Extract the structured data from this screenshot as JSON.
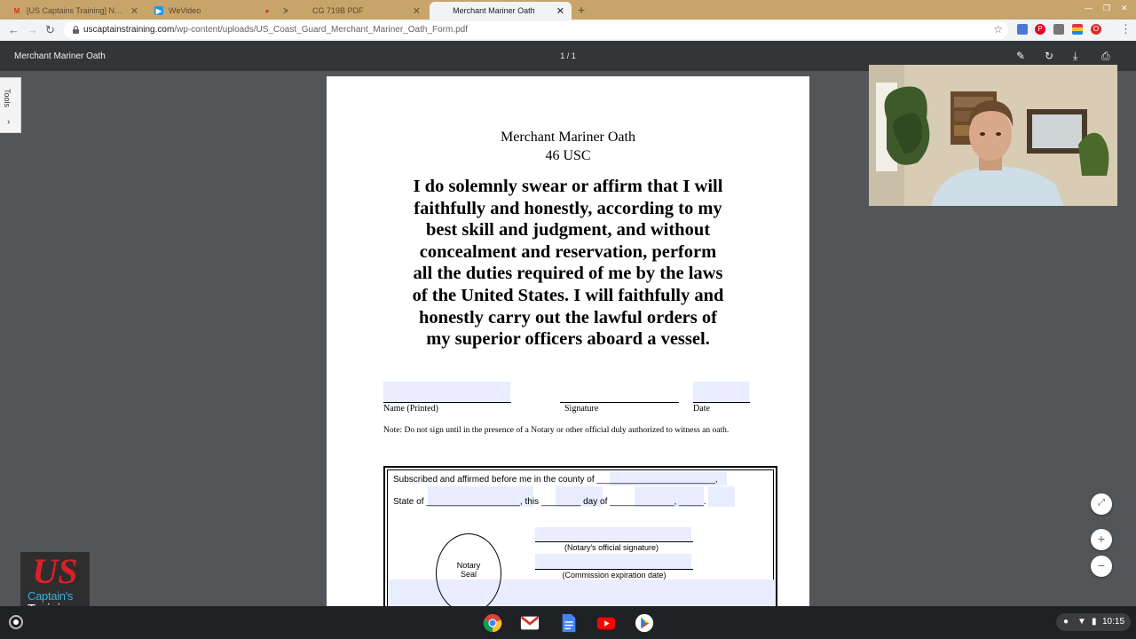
{
  "browser": {
    "tabs": [
      {
        "title": "[US Captains Training] New own...",
        "active": false
      },
      {
        "title": "WeVideo",
        "active": false
      },
      {
        "title": "",
        "active": false
      },
      {
        "title": "CG 719B PDF",
        "active": false
      },
      {
        "title": "Merchant Mariner Oath",
        "active": true
      }
    ],
    "new_tab_symbol": "+",
    "url_host": "uscaptainstraining.com",
    "url_path": "/wp-content/uploads/US_Coast_Guard_Merchant_Mariner_Oath_Form.pdf"
  },
  "pdf_viewer": {
    "title": "Merchant Mariner Oath",
    "page_indicator": "1 / 1",
    "tools_label": "Tools"
  },
  "document": {
    "title": "Merchant Mariner Oath",
    "subtitle": "46 USC",
    "oath_lines": [
      "I do solemnly swear or affirm that I will",
      "faithfully and honestly, according to my",
      "best skill and judgment, and without",
      "concealment and reservation, perform",
      "all the duties required of me by the laws",
      "of the United States. I will faithfully and",
      "honestly carry out the lawful orders of",
      "my superior officers aboard a vessel."
    ],
    "field_name_label": "Name (Printed)",
    "field_signature_label": "Signature",
    "field_date_label": "Date",
    "note": "Note: Do not sign until in the presence of a Notary or other official duly authorized to witness an oath.",
    "notary": {
      "line1_prefix": "Subscribed and affirmed before me in the county of",
      "line1_blank": "________________________",
      "line1_suffix": ",",
      "state_of": "State of",
      "state_blank": "___________________",
      "this": ", this",
      "this_blank": "________",
      "day_of": "day of",
      "day_blank": "_____________",
      "comma": ",",
      "year_blank": "_____",
      "period": ".",
      "seal_line1": "Notary",
      "seal_line2": "Seal",
      "signature_label": "(Notary's official signature)",
      "commission_label": "(Commission expiration date)"
    }
  },
  "logo": {
    "mark": "US",
    "line1": "Captain's",
    "line2": "Training"
  },
  "shelf": {
    "time": "10:15"
  },
  "colors": {
    "tabstrip": "#c6a46a",
    "pdf_toolbar": "#323639",
    "viewer_bg": "#525659",
    "form_field_fill": "#e8eeff",
    "logo_red": "#d92027",
    "logo_blue": "#3aaee0"
  }
}
